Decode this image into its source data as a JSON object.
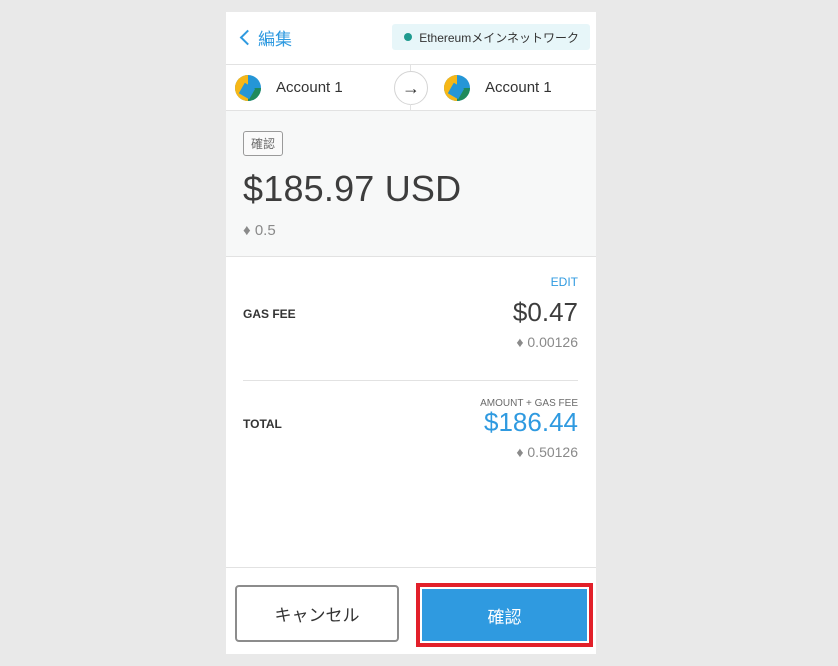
{
  "header": {
    "back_label": "編集",
    "network_label": "Ethereumメインネットワーク",
    "network_dot_color": "#1f9a8f"
  },
  "accounts": {
    "from_name": "Account 1",
    "to_name": "Account 1",
    "arrow_icon": "arrow-right-icon"
  },
  "summary": {
    "badge_label": "確認",
    "amount_usd": "$185.97 USD",
    "amount_eth": "♦ 0.5"
  },
  "gas": {
    "edit_label": "EDIT",
    "label": "GAS FEE",
    "usd": "$0.47",
    "eth": "♦ 0.00126"
  },
  "total": {
    "subheading": "AMOUNT + GAS FEE",
    "label": "TOTAL",
    "usd": "$186.44",
    "eth": "♦ 0.50126"
  },
  "footer": {
    "cancel_label": "キャンセル",
    "confirm_label": "確認",
    "accent_color": "#2f9ae0",
    "highlight_color": "#e2202a"
  }
}
